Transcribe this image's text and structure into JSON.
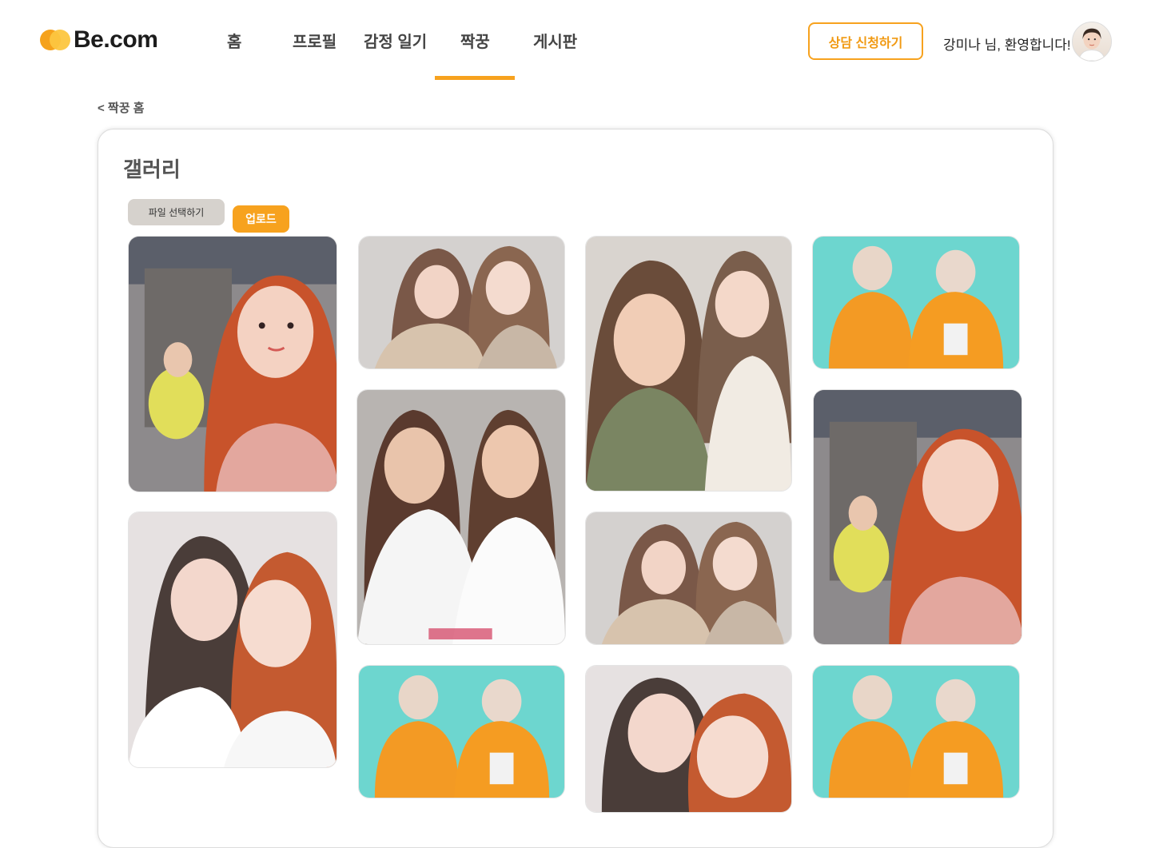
{
  "header": {
    "logo_text": "Be.com",
    "nav": [
      {
        "label": "홈"
      },
      {
        "label": "프로필"
      },
      {
        "label": "감정 일기"
      },
      {
        "label": "짝꿍"
      },
      {
        "label": "게시판"
      }
    ],
    "active_nav": "짝꿍",
    "consult_button": "상담 신청하기",
    "welcome": "강미나 님, 환영합니다!"
  },
  "back_link": "< 짝꿍 홈",
  "gallery": {
    "title": "갤러리",
    "file_select_button": "파일 선택하기",
    "upload_button": "업로드"
  },
  "colors": {
    "accent": "#f7a21e",
    "logo_dark": "#1c1c1c"
  },
  "icons": [
    "logo-heart-icon",
    "user-avatar"
  ]
}
